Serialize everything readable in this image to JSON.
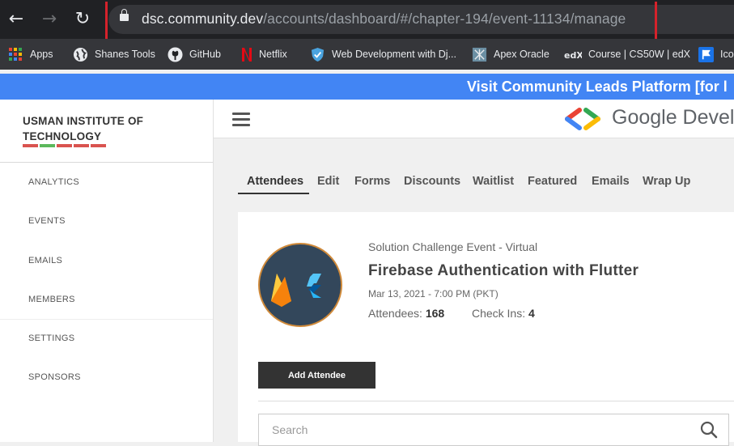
{
  "browser": {
    "nav": {
      "back": "←",
      "forward": "→",
      "reload": "↻"
    },
    "url_host": "dsc.community.dev",
    "url_path": "/accounts/dashboard/#/chapter-194/event-11134/manage",
    "bookmarks": [
      {
        "label": "Apps",
        "icon": "apps-grid-icon"
      },
      {
        "label": "Shanes Tools",
        "icon": "globe-icon"
      },
      {
        "label": "GitHub",
        "icon": "github-icon"
      },
      {
        "label": "Netflix",
        "icon": "netflix-icon"
      },
      {
        "label": "Web Development with Dj...",
        "icon": "shield-icon"
      },
      {
        "label": "Apex Oracle",
        "icon": "apex-icon"
      },
      {
        "label": "Course | CS50W | edX",
        "icon": "edx-icon"
      },
      {
        "label": "Ico",
        "icon": "flag-icon"
      }
    ]
  },
  "banner": {
    "text": "Visit Community Leads Platform [for l"
  },
  "sidebar": {
    "org_name": "USMAN INSTITUTE OF TECHNOLOGY",
    "bar_colors": [
      "#d9534f",
      "#5cb85c",
      "#d9534f",
      "#d9534f",
      "#d9534f"
    ],
    "items": [
      {
        "label": "ANALYTICS"
      },
      {
        "label": "EVENTS"
      },
      {
        "label": "EMAILS"
      },
      {
        "label": "MEMBERS"
      },
      {
        "label": "SETTINGS"
      },
      {
        "label": "SPONSORS"
      }
    ]
  },
  "header": {
    "logo_text": "Google Devel"
  },
  "tabs": [
    {
      "label": "Attendees",
      "active": true
    },
    {
      "label": "Edit"
    },
    {
      "label": "Forms"
    },
    {
      "label": "Discounts"
    },
    {
      "label": "Waitlist"
    },
    {
      "label": "Featured"
    },
    {
      "label": "Emails"
    },
    {
      "label": "Wrap Up"
    }
  ],
  "event": {
    "type": "Solution Challenge Event - Virtual",
    "title": "Firebase Authentication with Flutter",
    "date": "Mar 13, 2021 - 7:00 PM (PKT)",
    "attendees_label": "Attendees:",
    "attendees_count": "168",
    "checkins_label": "Check Ins:",
    "checkins_count": "4"
  },
  "actions": {
    "add_attendee": "Add Attendee"
  },
  "search": {
    "placeholder": "Search"
  },
  "colors": {
    "banner": "#4285f4",
    "chrome_bar": "#202124",
    "highlight_box": "#d6222b"
  }
}
